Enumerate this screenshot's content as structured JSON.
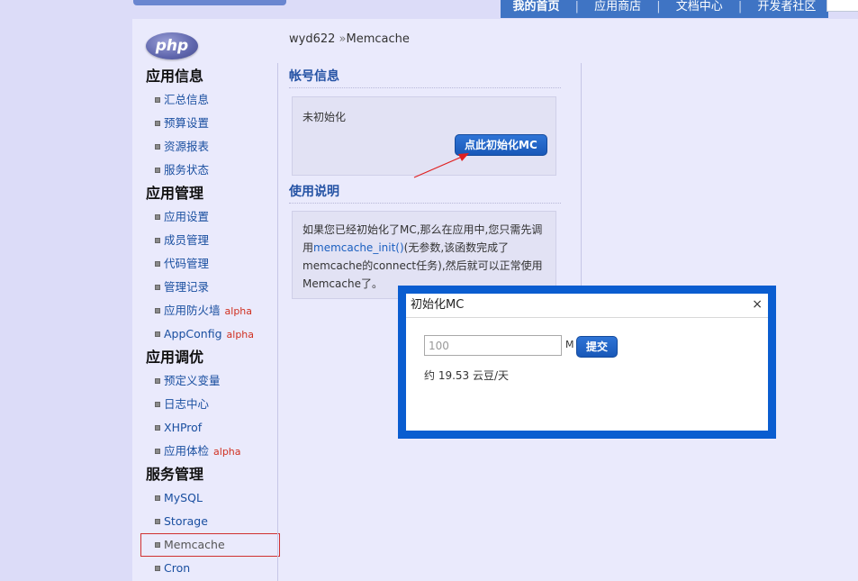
{
  "topnav": {
    "items": [
      "我的首页",
      "应用商店",
      "文档中心",
      "开发者社区"
    ]
  },
  "logo_text": "php",
  "breadcrumb": {
    "user": "wyd622",
    "separator": "»",
    "page": "Memcache"
  },
  "sidebar": {
    "groups": [
      {
        "title": "应用信息",
        "items": [
          {
            "label": "汇总信息"
          },
          {
            "label": "预算设置"
          },
          {
            "label": "资源报表"
          },
          {
            "label": "服务状态"
          }
        ]
      },
      {
        "title": "应用管理",
        "items": [
          {
            "label": "应用设置"
          },
          {
            "label": "成员管理"
          },
          {
            "label": "代码管理"
          },
          {
            "label": "管理记录"
          },
          {
            "label": "应用防火墙",
            "badge": "alpha"
          },
          {
            "label": "AppConfig",
            "badge": "alpha"
          }
        ]
      },
      {
        "title": "应用调优",
        "items": [
          {
            "label": "预定义变量"
          },
          {
            "label": "日志中心"
          },
          {
            "label": "XHProf"
          },
          {
            "label": "应用体检",
            "badge": "alpha"
          }
        ]
      },
      {
        "title": "服务管理",
        "items": [
          {
            "label": "MySQL"
          },
          {
            "label": "Storage"
          },
          {
            "label": "Memcache"
          },
          {
            "label": "Cron"
          }
        ]
      }
    ]
  },
  "account": {
    "title": "帐号信息",
    "status": "未初始化",
    "init_button": "点此初始化MC"
  },
  "usage": {
    "title": "使用说明",
    "text_before": "如果您已经初始化了MC,那么在应用中,您只需先调用",
    "fn": "memcache_init()",
    "text_after": "(无参数,该函数完成了memcache的connect任务),然后就可以正常使用Memcache了。"
  },
  "dialog": {
    "title": "初始化MC",
    "close": "×",
    "input_value": "100",
    "unit": "M",
    "submit": "提交",
    "estimate": "约 19.53 云豆/天"
  },
  "colors": {
    "accent": "#1958b8",
    "link": "#1a4fa0",
    "alpha_badge": "#d03020",
    "dialog_frame": "#0a5dd0",
    "annotation": "#e02020"
  }
}
